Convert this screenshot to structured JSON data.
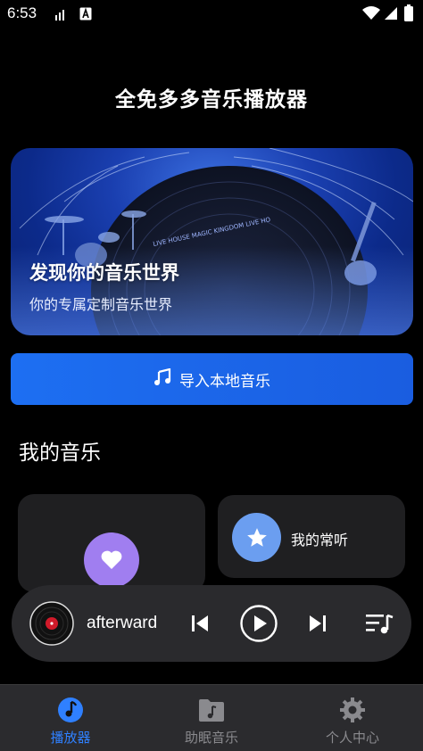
{
  "status_bar": {
    "time": "6:53",
    "icons": [
      "signal-bars-icon",
      "a-letter-icon",
      "wifi-icon",
      "cellular-icon",
      "battery-icon"
    ]
  },
  "app": {
    "title": "全免多多音乐播放器"
  },
  "banner": {
    "title": "发现你的音乐世界",
    "subtitle": "你的专属定制音乐世界",
    "art_text": "LIVE HOUSE MAGIC KINGDOM LIVE HO"
  },
  "import_button": {
    "label": "导入本地音乐",
    "icon": "music-note-icon"
  },
  "my_music": {
    "title": "我的音乐",
    "cards": [
      {
        "icon": "heart-icon",
        "label": ""
      },
      {
        "icon": "star-icon",
        "label": "我的常听"
      }
    ]
  },
  "player": {
    "track": "afterward",
    "controls": [
      "previous-icon",
      "play-icon",
      "next-icon",
      "playlist-icon"
    ]
  },
  "bottom_nav": {
    "items": [
      {
        "label": "播放器",
        "icon": "music-disc-icon",
        "active": true
      },
      {
        "label": "助眠音乐",
        "icon": "music-folder-icon",
        "active": false
      },
      {
        "label": "个人中心",
        "icon": "gear-icon",
        "active": false
      }
    ]
  },
  "colors": {
    "accent": "#1d6ff2",
    "active_nav": "#2f80ff",
    "inactive_nav": "#8a8a8e",
    "fav_purple": "#a07ef0",
    "often_blue": "#6b9ef0"
  }
}
